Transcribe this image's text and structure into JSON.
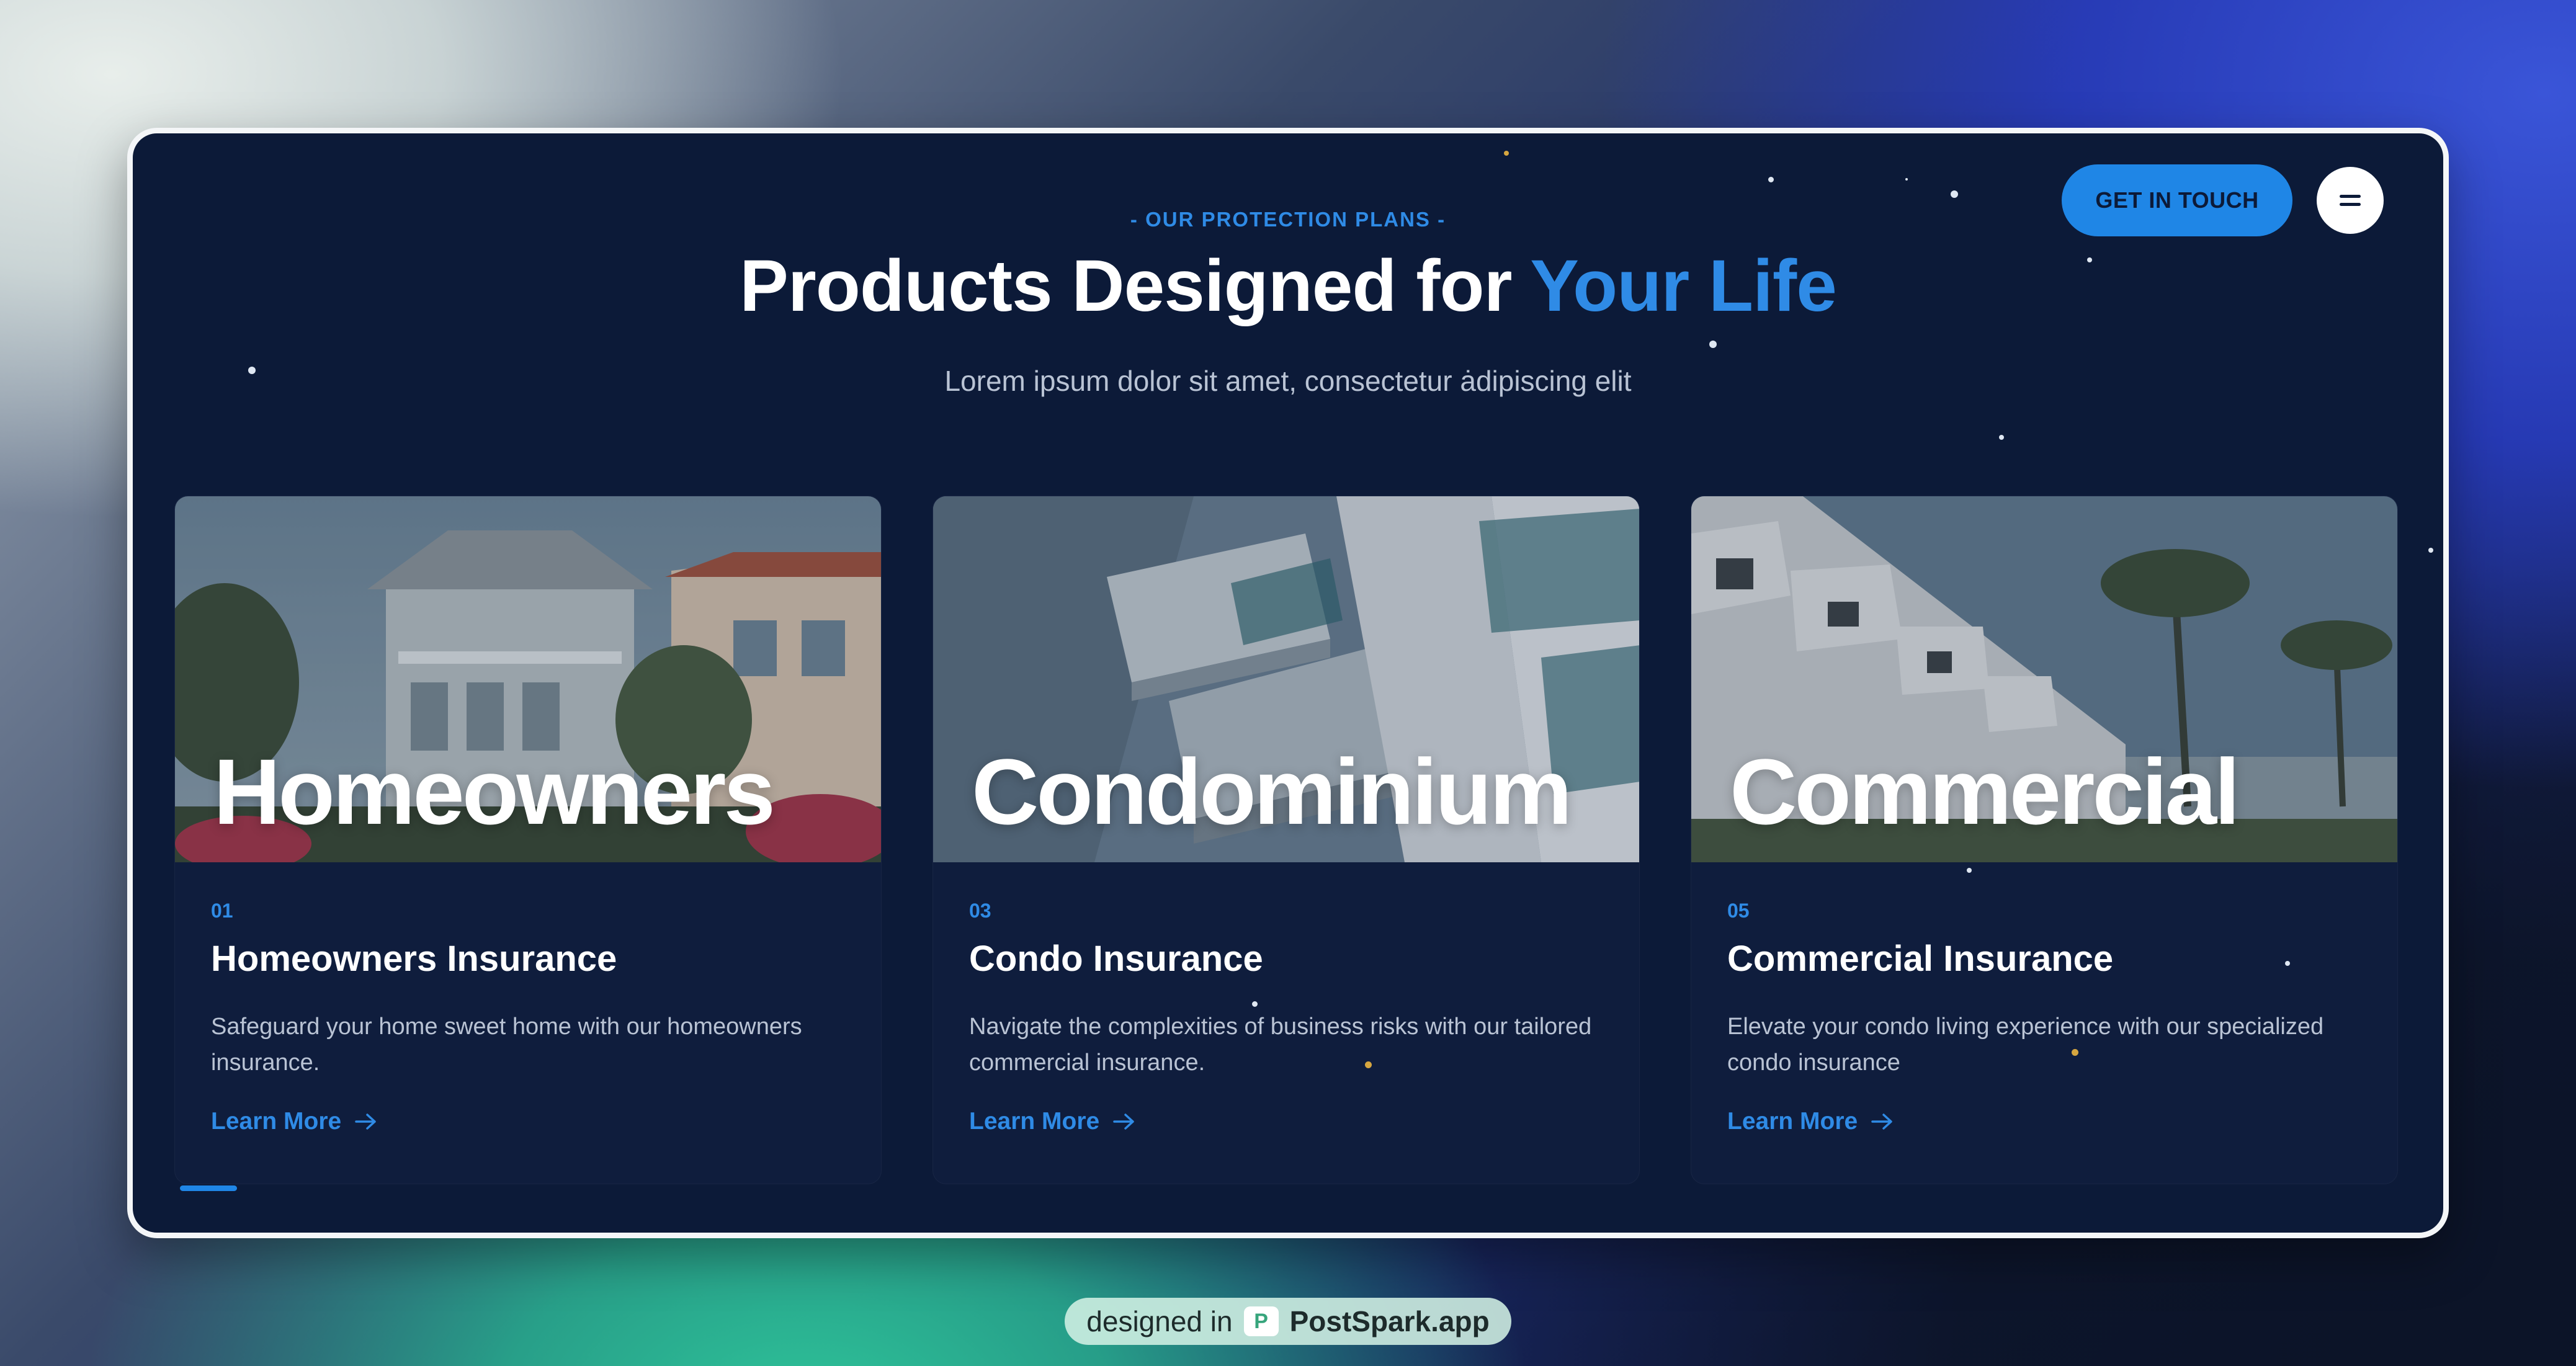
{
  "header": {
    "eyebrow": "- OUR PROTECTION PLANS -",
    "headline_main": "Products Designed for",
    "headline_accent": "Your Life",
    "subtitle": "Lorem ipsum dolor sit amet, consectetur ȧdipiscing elit"
  },
  "nav": {
    "cta_label": "GET IN TOUCH",
    "menu_icon": "menu-icon"
  },
  "cards": [
    {
      "image_word": "Homeowners",
      "number": "01",
      "title": "Homeowners Insurance",
      "description": "Safeguard your home sweet home with our homeowners insurance.",
      "link_label": "Learn More"
    },
    {
      "image_word": "Condominium",
      "number": "03",
      "title": "Condo Insurance",
      "description": "Navigate the complexities of business risks with our tailored commercial insurance.",
      "link_label": "Learn More"
    },
    {
      "image_word": "Commercial",
      "number": "05",
      "title": "Commercial Insurance",
      "description": "Elevate your condo living experience with our specialized condo insurance",
      "link_label": "Learn More"
    }
  ],
  "footer_badge": {
    "prefix": "designed in",
    "brand": "PostSpark.app",
    "icon": "postspark-logo-icon"
  },
  "colors": {
    "accent": "#2f8be6",
    "panel": "#0c1a38",
    "card": "#0f1d3d"
  }
}
